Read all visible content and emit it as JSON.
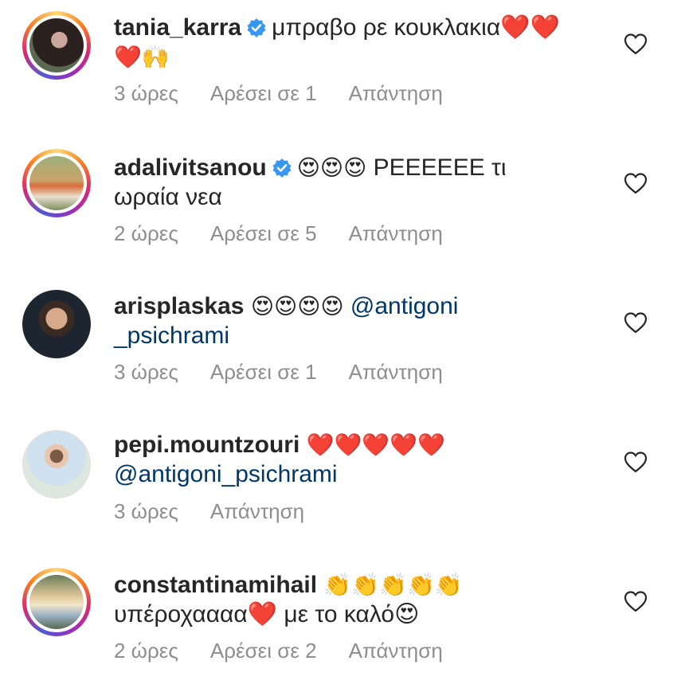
{
  "colors": {
    "text": "#262626",
    "meta": "#8e8e8e",
    "mention": "#00376b",
    "verified": "#3897f0",
    "heart_emoji": "#e0245e"
  },
  "comments": [
    {
      "username": "tania_karra",
      "verified": true,
      "text_1": "μπραβο ρε κουκλακια❤️❤️",
      "text_2": "❤️🙌",
      "time": "3 ώρες",
      "likes": "Αρέσει σε 1",
      "reply": "Απάντηση"
    },
    {
      "username": "adalivitsanou",
      "verified": true,
      "emoji": "😍😍😍",
      "text_1": "ΡΕΕΕΕΕΕ τι",
      "text_2": "ωραία νεα",
      "time": "2 ώρες",
      "likes": "Αρέσει σε 5",
      "reply": "Απάντηση"
    },
    {
      "username": "arisplaskas",
      "verified": false,
      "emoji": "😍😍😍😍",
      "mention_1": "@antigoni",
      "mention_2": "_psichrami",
      "time": "3 ώρες",
      "likes": "Αρέσει σε 1",
      "reply": "Απάντηση"
    },
    {
      "username": "pepi.mountzouri",
      "verified": false,
      "emoji": "❤️❤️❤️❤️❤️",
      "mention_2": "@antigoni_psichrami",
      "time": "3 ώρες",
      "reply": "Απάντηση"
    },
    {
      "username": "constantinamihail",
      "verified": false,
      "emoji": "👏👏👏👏👏",
      "text_2": "υπέροχαααα❤️ με το καλό😍",
      "time": "2 ώρες",
      "likes": "Αρέσει σε 2",
      "reply": "Απάντηση"
    }
  ]
}
